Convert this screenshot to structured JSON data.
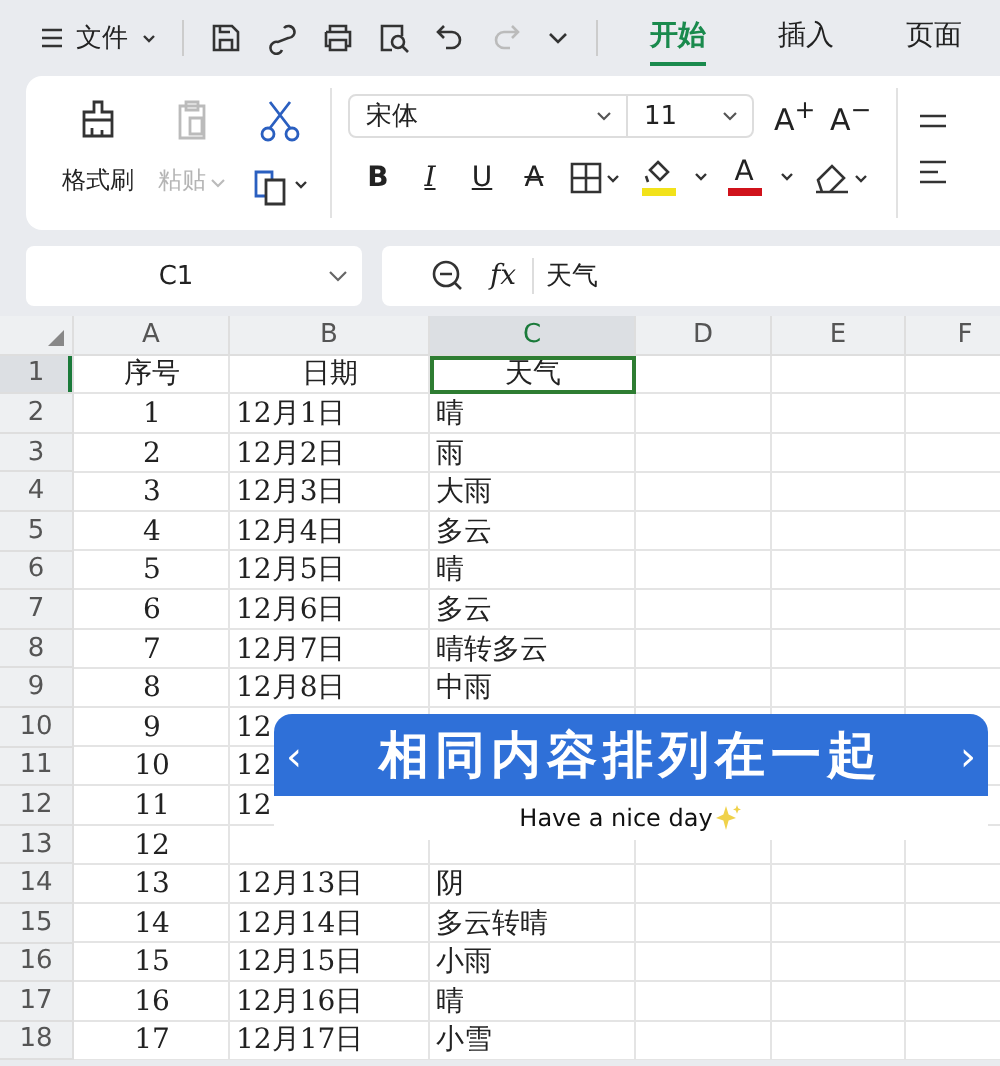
{
  "menu_bar": {
    "menu_label": "文件",
    "tabs": [
      {
        "label": "开始",
        "selected": true
      },
      {
        "label": "插入",
        "selected": false
      },
      {
        "label": "页面",
        "selected": false
      }
    ]
  },
  "ribbon": {
    "format_painter": "格式刷",
    "paste": {
      "label": "粘贴",
      "disabled": true
    },
    "font": "宋体",
    "font_size": "11",
    "size_buttons": [
      "A$^{+}$",
      "A$^{−}$"
    ],
    "format_buttons": [
      {
        "kind": "bold",
        "label": "B"
      },
      {
        "kind": "italic",
        "label": "I"
      },
      {
        "kind": "underline",
        "label": "U"
      },
      {
        "kind": "strike",
        "label": "A"
      }
    ],
    "color_buttons": [
      {
        "kind": "fill",
        "color": "#f2e21a"
      },
      {
        "kind": "font",
        "label": "A",
        "color": "#d0121b"
      }
    ]
  },
  "formula_bar": {
    "cell_ref": "C1",
    "fx": "fx",
    "content": "天气"
  },
  "sheet": {
    "columns": [
      {
        "label": "A",
        "selected": false
      },
      {
        "label": "B",
        "selected": false
      },
      {
        "label": "C",
        "selected": true
      },
      {
        "label": "D",
        "selected": false
      },
      {
        "label": "E",
        "selected": false
      },
      {
        "label": "F",
        "selected": false
      }
    ],
    "rows": [
      {
        "number": "1",
        "kind": "header",
        "selected": true,
        "cells": [
          "序号",
          "日期",
          "天气"
        ]
      },
      {
        "number": "2",
        "kind": "data",
        "selected": false,
        "cells": [
          "1",
          "12月1日",
          "晴"
        ]
      },
      {
        "number": "3",
        "kind": "data",
        "selected": false,
        "cells": [
          "2",
          "12月2日",
          "雨"
        ]
      },
      {
        "number": "4",
        "kind": "data",
        "selected": false,
        "cells": [
          "3",
          "12月3日",
          "大雨"
        ]
      },
      {
        "number": "5",
        "kind": "data",
        "selected": false,
        "cells": [
          "4",
          "12月4日",
          "多云"
        ]
      },
      {
        "number": "6",
        "kind": "data",
        "selected": false,
        "cells": [
          "5",
          "12月5日",
          "晴"
        ]
      },
      {
        "number": "7",
        "kind": "data",
        "selected": false,
        "cells": [
          "6",
          "12月6日",
          "多云"
        ]
      },
      {
        "number": "8",
        "kind": "data",
        "selected": false,
        "cells": [
          "7",
          "12月7日",
          "晴转多云"
        ]
      },
      {
        "number": "9",
        "kind": "data",
        "selected": false,
        "cells": [
          "8",
          "12月8日",
          "中雨"
        ]
      },
      {
        "number": "10",
        "kind": "data",
        "selected": false,
        "cells": [
          "9",
          "12"
        ]
      },
      {
        "number": "11",
        "kind": "data",
        "selected": false,
        "cells": [
          "10",
          "12"
        ]
      },
      {
        "number": "12",
        "kind": "data",
        "selected": false,
        "cells": [
          "11",
          "12"
        ]
      },
      {
        "number": "13",
        "kind": "data",
        "selected": false,
        "cells": [
          "12"
        ]
      },
      {
        "number": "14",
        "kind": "data",
        "selected": false,
        "cells": [
          "13",
          "12月13日",
          "阴"
        ]
      },
      {
        "number": "15",
        "kind": "data",
        "selected": false,
        "cells": [
          "14",
          "12月14日",
          "多云转晴"
        ]
      },
      {
        "number": "16",
        "kind": "data",
        "selected": false,
        "cells": [
          "15",
          "12月15日",
          "小雨"
        ]
      },
      {
        "number": "17",
        "kind": "data",
        "selected": false,
        "cells": [
          "16",
          "12月16日",
          "晴"
        ]
      },
      {
        "number": "18",
        "kind": "data",
        "selected": false,
        "cells": [
          "17",
          "12月17日",
          "小雪"
        ]
      }
    ]
  },
  "banner": {
    "prev": "‹",
    "title": "相同内容排列在一起",
    "next": "›",
    "subtitle": "Have a nice day"
  }
}
